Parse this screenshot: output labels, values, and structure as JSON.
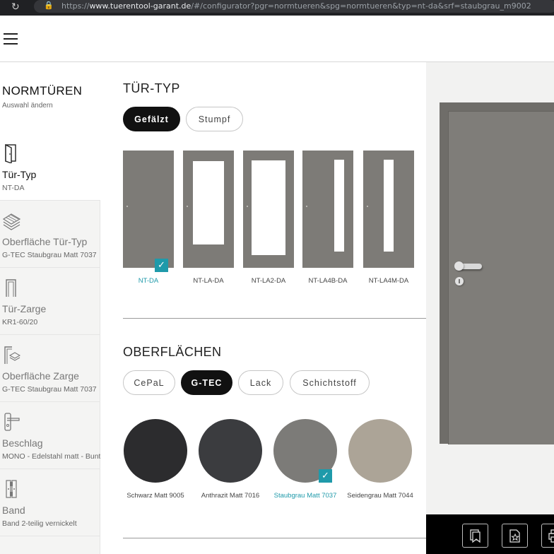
{
  "browser": {
    "url_prefix": "https://",
    "url_host": "www.tuerentool-garant.de",
    "url_rest": "/#/configurator?pgr=normtueren&spg=normtueren&typ=nt-da&srf=staubgrau_m9002"
  },
  "sidebar": {
    "header": {
      "title": "NORMTÜREN",
      "subtitle": "Auswahl ändern"
    },
    "items": [
      {
        "label": "Tür-Typ",
        "value": "NT-DA"
      },
      {
        "label": "Oberfläche Tür-Typ",
        "value": "G-TEC Staubgrau Matt 7037"
      },
      {
        "label": "Tür-Zarge",
        "value": "KR1-60/20"
      },
      {
        "label": "Oberfläche Zarge",
        "value": "G-TEC Staubgrau Matt 7037"
      },
      {
        "label": "Beschlag",
        "value": "MONO - Edelstahl matt - Bunt"
      },
      {
        "label": "Band",
        "value": "Band 2-teilig vernickelt"
      }
    ]
  },
  "door_type": {
    "title": "TÜR-TYP",
    "tabs": [
      "Gefälzt",
      "Stumpf"
    ],
    "selected_tab": "Gefälzt",
    "options": [
      "NT-DA",
      "NT-LA-DA",
      "NT-LA2-DA",
      "NT-LA4B-DA",
      "NT-LA4M-DA"
    ],
    "selected_option": "NT-DA",
    "check_glyph": "✓"
  },
  "surfaces": {
    "title": "OBERFLÄCHEN",
    "tabs": [
      "CePaL",
      "G-TEC",
      "Lack",
      "Schichtstoff"
    ],
    "selected_tab": "G-TEC",
    "swatches": [
      {
        "label": "Schwarz Matt 9005",
        "color": "#2c2c2e"
      },
      {
        "label": "Anthrazit Matt 7016",
        "color": "#3b3c3f"
      },
      {
        "label": "Staubgrau Matt 7037",
        "color": "#7c7b78"
      },
      {
        "label": "Seidengrau Matt 7044",
        "color": "#aca497"
      }
    ],
    "selected_swatch": "Staubgrau Matt 7037"
  },
  "colors": {
    "accent": "#1f9aaa",
    "selected_button": "#111111",
    "door": "#7f7d79"
  },
  "toolbar": {
    "icons": [
      "bookmark-icon",
      "favorite-page-icon",
      "print-icon"
    ]
  }
}
